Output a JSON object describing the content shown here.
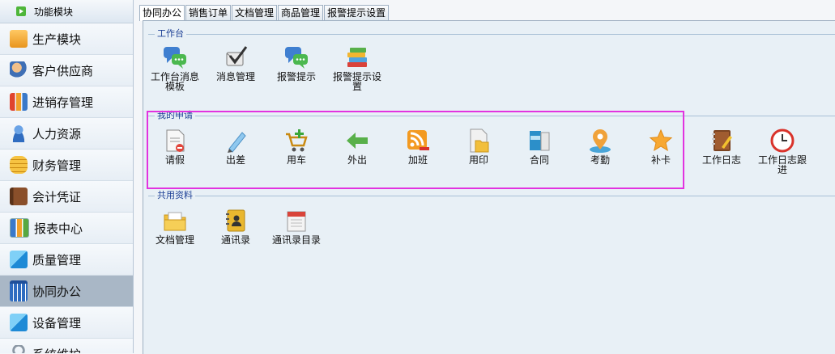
{
  "sidebar": {
    "header": "功能模块",
    "items": [
      {
        "label": "生产模块",
        "icon": "folder-icon"
      },
      {
        "label": "客户供应商",
        "icon": "contacts-icon"
      },
      {
        "label": "进销存管理",
        "icon": "bar-chart-icon"
      },
      {
        "label": "人力资源",
        "icon": "user-icon"
      },
      {
        "label": "财务管理",
        "icon": "coins-icon"
      },
      {
        "label": "会计凭证",
        "icon": "ledger-icon"
      },
      {
        "label": "报表中心",
        "icon": "report-icon"
      },
      {
        "label": "质量管理",
        "icon": "tiles-icon"
      },
      {
        "label": "协同办公",
        "icon": "calendar-icon",
        "active": true
      },
      {
        "label": "设备管理",
        "icon": "tiles-icon"
      },
      {
        "label": "系统维护",
        "icon": "lock-icon"
      }
    ]
  },
  "tabs": [
    {
      "label": "协同办公",
      "active": true
    },
    {
      "label": "销售订单"
    },
    {
      "label": "文档管理"
    },
    {
      "label": "商品管理"
    },
    {
      "label": "报警提示设置"
    }
  ],
  "sections": {
    "workbench": {
      "title": "工作台",
      "items": [
        {
          "label": "工作台消息",
          "label2": "模板",
          "icon": "chat-bubbles-icon"
        },
        {
          "label": "消息管理",
          "icon": "message-check-icon"
        },
        {
          "label": "报警提示",
          "icon": "chat-bubbles-icon"
        },
        {
          "label": "报警提示设",
          "label2": "置",
          "icon": "books-stack-icon"
        }
      ]
    },
    "my_requests": {
      "title": "我的申请",
      "items": [
        {
          "label": "请假",
          "icon": "leave-form-icon"
        },
        {
          "label": "出差",
          "icon": "pen-icon"
        },
        {
          "label": "用车",
          "icon": "cart-add-icon"
        },
        {
          "label": "外出",
          "icon": "arrow-left-icon"
        },
        {
          "label": "加班",
          "icon": "rss-minus-icon"
        },
        {
          "label": "用印",
          "icon": "folder-doc-icon"
        },
        {
          "label": "合同",
          "icon": "binder-icon"
        },
        {
          "label": "考勤",
          "icon": "map-pin-icon"
        },
        {
          "label": "补卡",
          "icon": "star-icon"
        },
        {
          "label": "工作日志",
          "icon": "notebook-icon"
        },
        {
          "label": "工作日志跟",
          "label2": "进",
          "icon": "clock-icon"
        }
      ]
    },
    "shared": {
      "title": "共用资料",
      "items": [
        {
          "label": "文档管理",
          "icon": "folder-open-icon"
        },
        {
          "label": "通讯录",
          "icon": "address-book-icon"
        },
        {
          "label": "通讯录目录",
          "icon": "calendar-doc-icon"
        }
      ]
    }
  },
  "colors": {
    "highlight": "#e233e0",
    "section_title": "#1c3f95",
    "active_sidebar": "#a9b7c6"
  }
}
